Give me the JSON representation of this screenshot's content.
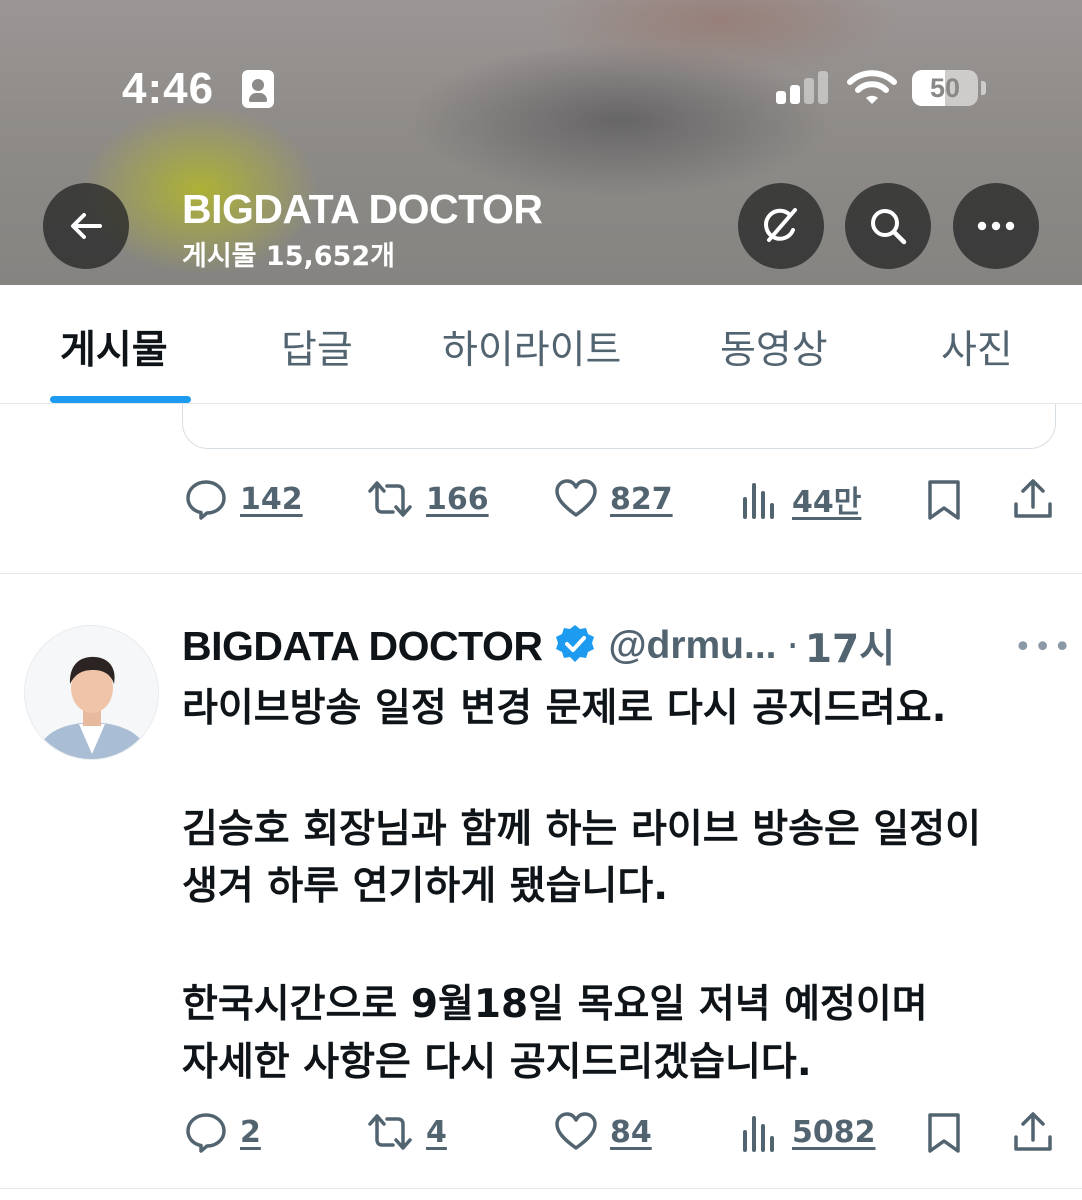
{
  "status_bar": {
    "time": "4:46",
    "battery": "50",
    "battery_level": 0.5
  },
  "header": {
    "profile_name": "BIGDATA DOCTOR",
    "post_count": "게시물 15,652개",
    "icons": [
      "back-arrow-icon",
      "grok-icon",
      "search-icon",
      "more-icon"
    ]
  },
  "tabs": [
    {
      "label": "게시물",
      "active": true
    },
    {
      "label": "답글",
      "active": false
    },
    {
      "label": "하이라이트",
      "active": false
    },
    {
      "label": "동영상",
      "active": false
    },
    {
      "label": "사진",
      "active": false
    }
  ],
  "tweets": [
    {
      "stats": {
        "replies": "142",
        "reposts": "166",
        "likes": "827",
        "views": "44만"
      }
    },
    {
      "author": "BIGDATA DOCTOR",
      "handle": "@drmu...",
      "separator": "·",
      "time": "17시",
      "lines": [
        "라이브방송 일정 변경 문제로 다시 공지드려요.",
        "김승호 회장님과 함께 하는 라이브 방송은 일정이",
        "생겨 하루 연기하게 됐습니다.",
        "한국시간으로 9월18일 목요일 저녁 예정이며",
        "자세한 사항은 다시 공지드리겠습니다."
      ],
      "stats": {
        "replies": "2",
        "reposts": "4",
        "likes": "84",
        "views": "5082"
      }
    }
  ],
  "colors": {
    "accent": "#1d9bf0",
    "secondary_text": "#536471",
    "primary_text": "#0f1419"
  }
}
